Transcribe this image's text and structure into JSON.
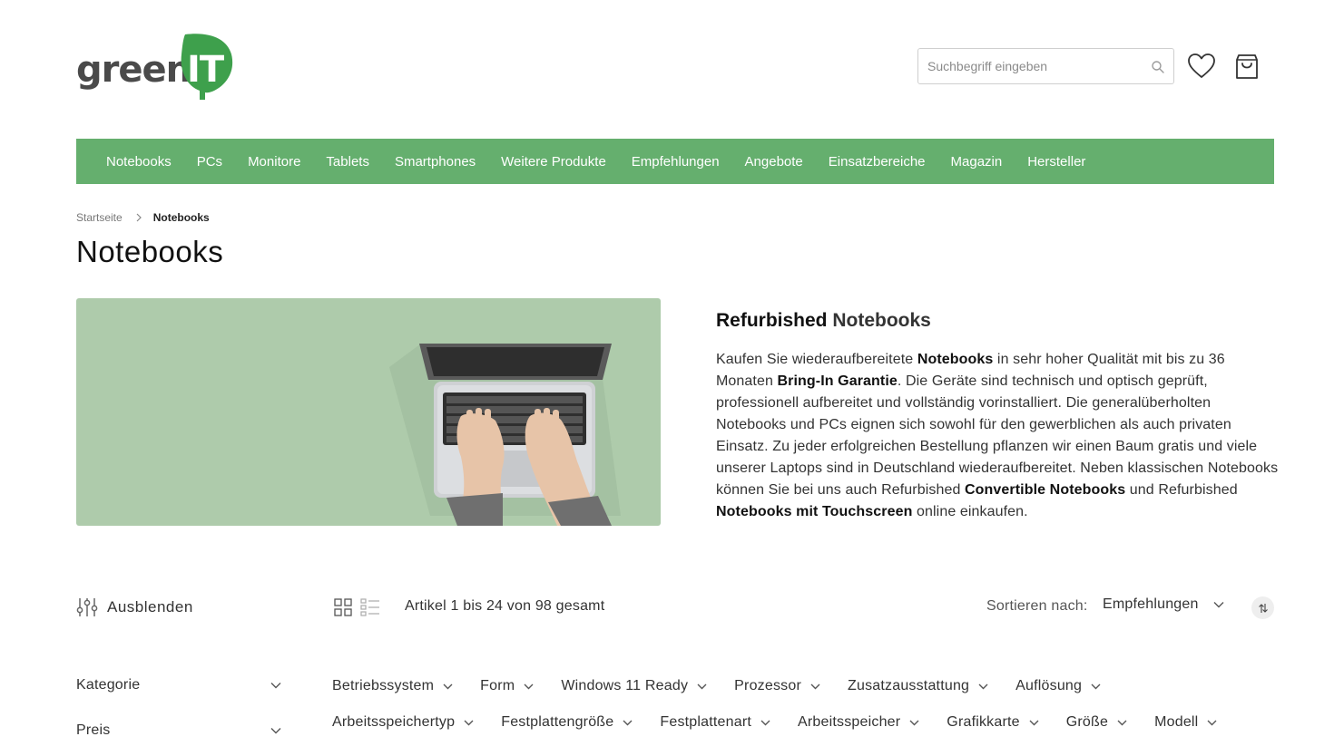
{
  "logo": {
    "text_green": "green",
    "text_it": "IT"
  },
  "search": {
    "placeholder": "Suchbegriff eingeben"
  },
  "nav": {
    "items": [
      "Notebooks",
      "PCs",
      "Monitore",
      "Tablets",
      "Smartphones",
      "Weitere Produkte",
      "Empfehlungen",
      "Angebote",
      "Einsatzbereiche",
      "Magazin",
      "Hersteller"
    ]
  },
  "breadcrumb": {
    "home": "Startseite",
    "current": "Notebooks"
  },
  "page_title": "Notebooks",
  "description": {
    "title_bold": "Refurbished",
    "title_rest": "Notebooks",
    "segments": [
      {
        "t": "Kaufen Sie wiederaufbereitete ",
        "b": false
      },
      {
        "t": "Notebooks",
        "b": true
      },
      {
        "t": " in sehr hoher Qualität mit bis zu 36 Monaten ",
        "b": false
      },
      {
        "t": "Bring-In Garantie",
        "b": true
      },
      {
        "t": ". Die Geräte sind technisch und optisch geprüft, professionell aufbereitet und vollständig vorinstalliert. Die generalüberholten Notebooks und PCs eignen sich sowohl für den gewerblichen als auch privaten Einsatz. Zu jeder erfolgreichen Bestellung pflanzen wir einen Baum gratis und viele unserer Laptops sind in Deutschland wiederaufbereitet. Neben klassischen Notebooks können Sie bei uns auch Refurbished ",
        "b": false
      },
      {
        "t": "Convertible Notebooks",
        "b": true
      },
      {
        "t": " und Refurbished ",
        "b": false
      },
      {
        "t": "Notebooks mit Touchscreen",
        "b": true
      },
      {
        "t": " online einkaufen.",
        "b": false
      }
    ]
  },
  "toolbar": {
    "hide_filters": "Ausblenden",
    "article_count": "Artikel 1 bis 24 von 98 gesamt",
    "sort_label": "Sortieren nach:",
    "sort_value": "Empfehlungen"
  },
  "side_filters": [
    "Kategorie",
    "Preis"
  ],
  "filter_chips_row1": [
    "Betriebssystem",
    "Form",
    "Windows 11 Ready",
    "Prozessor",
    "Zusatzausstattung",
    "Auflösung"
  ],
  "filter_chips_row2": [
    "Arbeitsspeichertyp",
    "Festplattengröße",
    "Festplattenart",
    "Arbeitsspeicher",
    "Grafikkarte",
    "Größe",
    "Modell"
  ],
  "colors": {
    "brand_green": "#65af6e",
    "hero_bg": "#aecbab"
  }
}
